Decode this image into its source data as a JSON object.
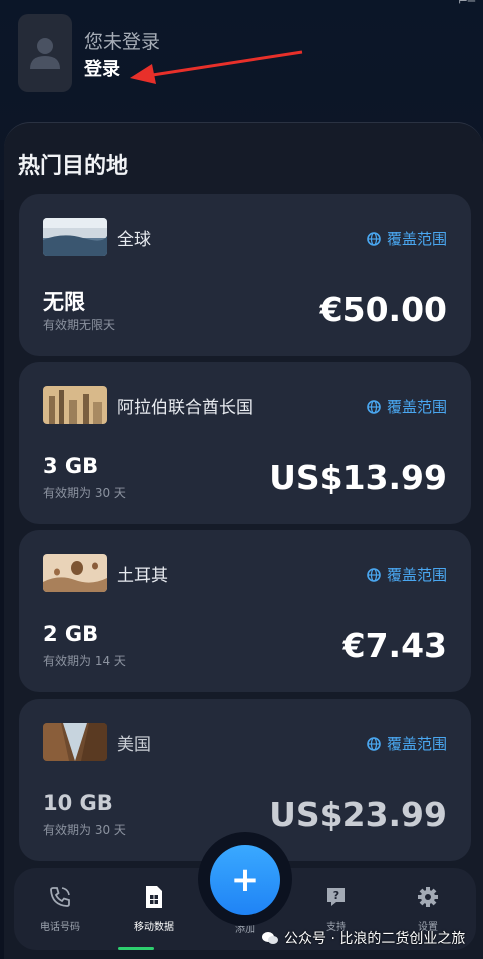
{
  "header": {
    "status_hint": "⌐─",
    "greeting": "您未登录",
    "login_label": "登录"
  },
  "section": {
    "title": "热门目的地"
  },
  "cards": [
    {
      "country": "全球",
      "coverage": "覆盖范围",
      "amount": "无限",
      "validity": "有效期无限天",
      "price": "€50.00"
    },
    {
      "country": "阿拉伯联合酋长国",
      "coverage": "覆盖范围",
      "amount": "3 GB",
      "validity": "有效期为 30 天",
      "price": "US$13.99"
    },
    {
      "country": "土耳其",
      "coverage": "覆盖范围",
      "amount": "2 GB",
      "validity": "有效期为 14 天",
      "price": "€7.43"
    },
    {
      "country": "美国",
      "coverage": "覆盖范围",
      "amount": "10 GB",
      "validity": "有效期为 30 天",
      "price": "US$23.99"
    }
  ],
  "tabs": {
    "phone": "电话号码",
    "data": "移动数据",
    "add": "添加",
    "support": "支持",
    "settings": "设置"
  },
  "fab": {
    "icon": "plus-icon",
    "label": "+"
  },
  "watermark": "公众号 · 比浪的二货创业之旅",
  "colors": {
    "accent": "#2b93f8",
    "coverage_link": "#4aa7f0",
    "active_indicator": "#2ecf6f"
  }
}
